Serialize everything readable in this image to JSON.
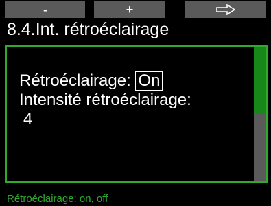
{
  "softkeys": {
    "left_label": "-",
    "center_label": "+",
    "right_icon": "arrow-right-icon"
  },
  "title": "8.4.Int. rétroéclairage",
  "settings": {
    "backlight_label": "Rétroéclairage:",
    "backlight_value": "On",
    "intensity_label": "Intensité rétroéclairage:",
    "intensity_value": "4"
  },
  "hint": "Rétroéclairage: on, off",
  "colors": {
    "accent_green": "#2faa2f",
    "scroll_thumb": "#18871a",
    "softkey_bg": "#5a5a5a"
  },
  "scroll": {
    "thumb_fraction": 0.5
  }
}
